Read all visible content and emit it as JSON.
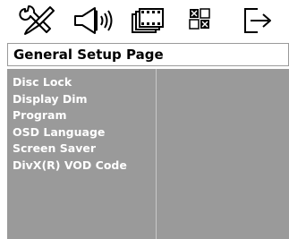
{
  "tabs": [
    {
      "icon": "tools-icon"
    },
    {
      "icon": "speaker-icon"
    },
    {
      "icon": "film-icon"
    },
    {
      "icon": "preferences-icon"
    },
    {
      "icon": "exit-icon"
    }
  ],
  "page": {
    "title": "General Setup Page"
  },
  "menu": {
    "items": [
      {
        "label": "Disc Lock"
      },
      {
        "label": "Display Dim"
      },
      {
        "label": "Program"
      },
      {
        "label": "OSD Language"
      },
      {
        "label": "Screen Saver"
      },
      {
        "label": "DivX(R) VOD Code"
      }
    ]
  },
  "colors": {
    "panel": "#9a9a9a",
    "menu_text": "#ffffff",
    "title_text": "#000000",
    "background": "#ffffff"
  }
}
